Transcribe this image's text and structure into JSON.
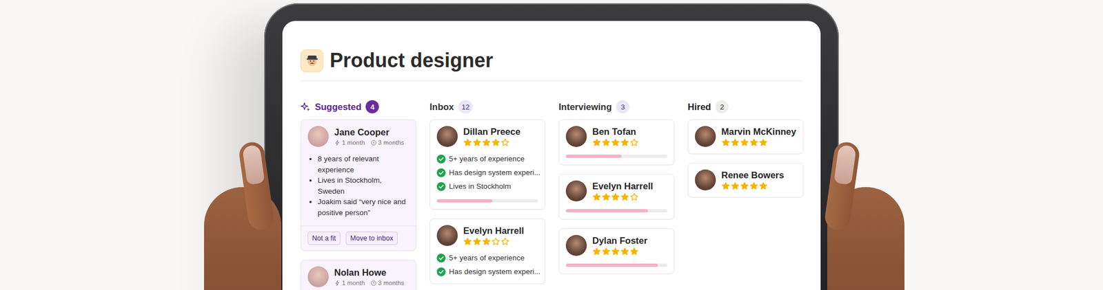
{
  "job": {
    "title": "Product designer"
  },
  "columns": [
    {
      "title": "Suggested",
      "count": "4",
      "kind": "suggested",
      "cards": [
        {
          "kind": "suggested",
          "name": "Jane Cooper",
          "meta": [
            "1 month",
            "3 months"
          ],
          "bullets": [
            "8 years of relevant experience",
            "Lives in Stockholm, Sweden",
            "Joakim said “very nice and positive person”"
          ],
          "actions": [
            "Not a fit",
            "Move to inbox"
          ]
        },
        {
          "kind": "suggested",
          "name": "Nolan Howe",
          "meta": [
            "1 month",
            "3 months"
          ],
          "bullets": [],
          "actions": []
        }
      ]
    },
    {
      "title": "Inbox",
      "count": "12",
      "kind": "active",
      "cards": [
        {
          "kind": "review",
          "name": "Dillan Preece",
          "stars": 4,
          "checks": [
            "5+ years of experience",
            "Has design system experi...",
            "Lives in Stockholm"
          ],
          "level": 0.55
        },
        {
          "kind": "review",
          "name": "Evelyn Harrell",
          "stars": 3,
          "checks": [
            "5+ years of experience",
            "Has design system experi..."
          ]
        }
      ]
    },
    {
      "title": "Interviewing",
      "count": "3",
      "kind": "active",
      "cards": [
        {
          "kind": "progress",
          "name": "Ben Tofan",
          "stars": 4,
          "level": 0.55
        },
        {
          "kind": "progress",
          "name": "Evelyn Harrell",
          "stars": 4,
          "level": 0.81
        },
        {
          "kind": "progress",
          "name": "Dylan Foster",
          "stars": 5,
          "level": 0.91
        }
      ]
    },
    {
      "title": "Hired",
      "count": "2",
      "kind": "final",
      "cards": [
        {
          "kind": "rated",
          "name": "Marvin McKinney",
          "stars": 5
        },
        {
          "kind": "rated",
          "name": "Renee Bowers",
          "stars": 5
        }
      ]
    }
  ]
}
